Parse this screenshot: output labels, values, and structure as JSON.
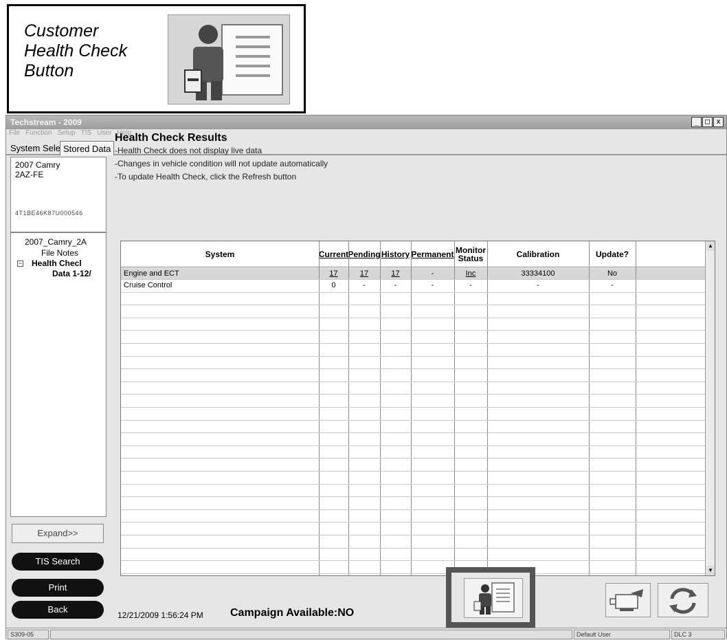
{
  "callout": {
    "label_lines": [
      "Customer",
      "Health Check",
      "Button"
    ]
  },
  "window": {
    "title": "Techstream - 2009",
    "controls": [
      "_",
      "□",
      "x"
    ],
    "menu": [
      "File",
      "Function",
      "Setup",
      "TIS",
      "User",
      "Help"
    ],
    "tabs": [
      "System Select",
      "Stored Data"
    ]
  },
  "vehicle": {
    "model": "2007 Camry",
    "engine": "2AZ-FE",
    "vin": "4T1BE46K87U000546"
  },
  "tree": {
    "root": "2007_Camry_2A",
    "file_notes": "File Notes",
    "expander": "−",
    "health_check": "Health Checl",
    "data": "Data 1-12/"
  },
  "left_buttons": {
    "expand": "Expand>>",
    "tis_search": "TIS Search",
    "print": "Print",
    "back": "Back"
  },
  "results": {
    "title": "Health Check Results",
    "notes": [
      "-Health Check does not display live data",
      "-Changes in vehicle condition will not update automatically",
      "-To update Health Check, click the Refresh button"
    ],
    "columns": [
      "System",
      "Current",
      "Pending",
      "History",
      "Permanent",
      "Monitor\nStatus",
      "Calibration",
      "Update?"
    ],
    "rows": [
      [
        "Engine and ECT",
        "17",
        "17",
        "17",
        "-",
        "Inc",
        "33334100",
        "No"
      ],
      [
        "Cruise Control",
        "0",
        "-",
        "-",
        "-",
        "-",
        "-",
        "-"
      ]
    ]
  },
  "footer": {
    "timestamp": "12/21/2009 1:56:24 PM",
    "campaign": "Campaign Available:NO"
  },
  "statusbar": {
    "code": "S309-05",
    "user": "Default User",
    "dlc": "DLC 3"
  }
}
